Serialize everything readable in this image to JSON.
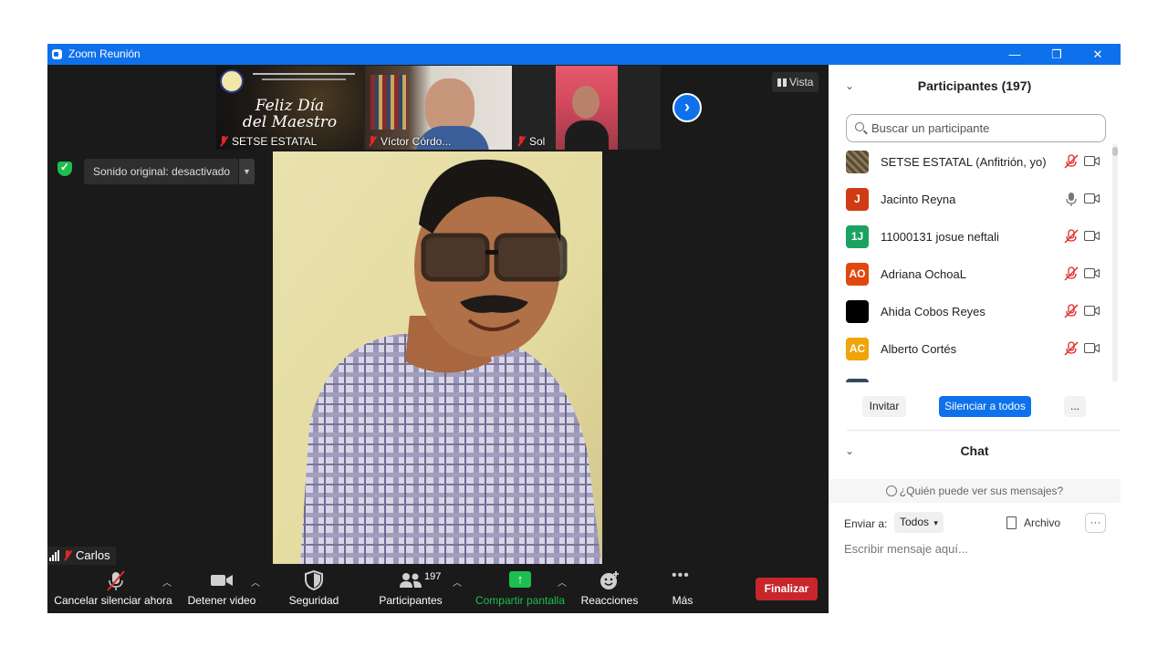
{
  "window": {
    "title": "Zoom Reunión",
    "controls": {
      "minimize": "—",
      "restore": "❐",
      "close": "✕"
    }
  },
  "thumbnails": [
    {
      "name": "SETSE ESTATAL",
      "muted": true,
      "banner_line1": "Feliz Día",
      "banner_line2": "del Maestro"
    },
    {
      "name": "Víctor Córdo...",
      "muted": true
    },
    {
      "name": "Sol",
      "muted": true
    }
  ],
  "view_button": {
    "label": "Vista",
    "icon": "grid-icon"
  },
  "audio": {
    "sound_original_label": "Sonido original: desactivado"
  },
  "active_speaker": {
    "name": "Carlos",
    "muted": true
  },
  "toolbar": {
    "unmute_label": "Cancelar silenciar ahora",
    "video_label": "Detener video",
    "security_label": "Seguridad",
    "participants_label": "Participantes",
    "participants_count": "197",
    "share_label": "Compartir pantalla",
    "reactions_label": "Reacciones",
    "more_label": "Más",
    "end_label": "Finalizar"
  },
  "panel": {
    "participants_title": "Participantes (197)",
    "search_placeholder": "Buscar un participante",
    "participants": [
      {
        "name": "SETSE ESTATAL (Anfitrión, yo)",
        "avatar": "",
        "avatar_color": "#6b5a3e",
        "mic": "muted"
      },
      {
        "name": "Jacinto Reyna",
        "avatar": "J",
        "avatar_color": "#d13b13",
        "mic": "on"
      },
      {
        "name": "11000131 josue neftali",
        "avatar": "1J",
        "avatar_color": "#1aa260",
        "mic": "muted"
      },
      {
        "name": "Adriana OchoaL",
        "avatar": "AO",
        "avatar_color": "#e0480f",
        "mic": "muted"
      },
      {
        "name": "Ahida Cobos Reyes",
        "avatar": "",
        "avatar_color": "#000000",
        "mic": "muted"
      },
      {
        "name": "Alberto Cortés",
        "avatar": "AC",
        "avatar_color": "#f0a40a",
        "mic": "muted"
      }
    ],
    "invite_label": "Invitar",
    "mute_all_label": "Silenciar a todos",
    "more_label": "...",
    "chat_title": "Chat",
    "who_sees": "¿Quién puede ver sus mensajes?",
    "send_to_label": "Enviar a:",
    "send_to_value": "Todos",
    "file_label": "Archivo",
    "chat_more": "···",
    "message_placeholder": "Escribir mensaje aquí..."
  },
  "colors": {
    "accent": "#0e71eb",
    "end": "#c8262b",
    "share": "#1dbe4f",
    "muted": "#e02828"
  }
}
